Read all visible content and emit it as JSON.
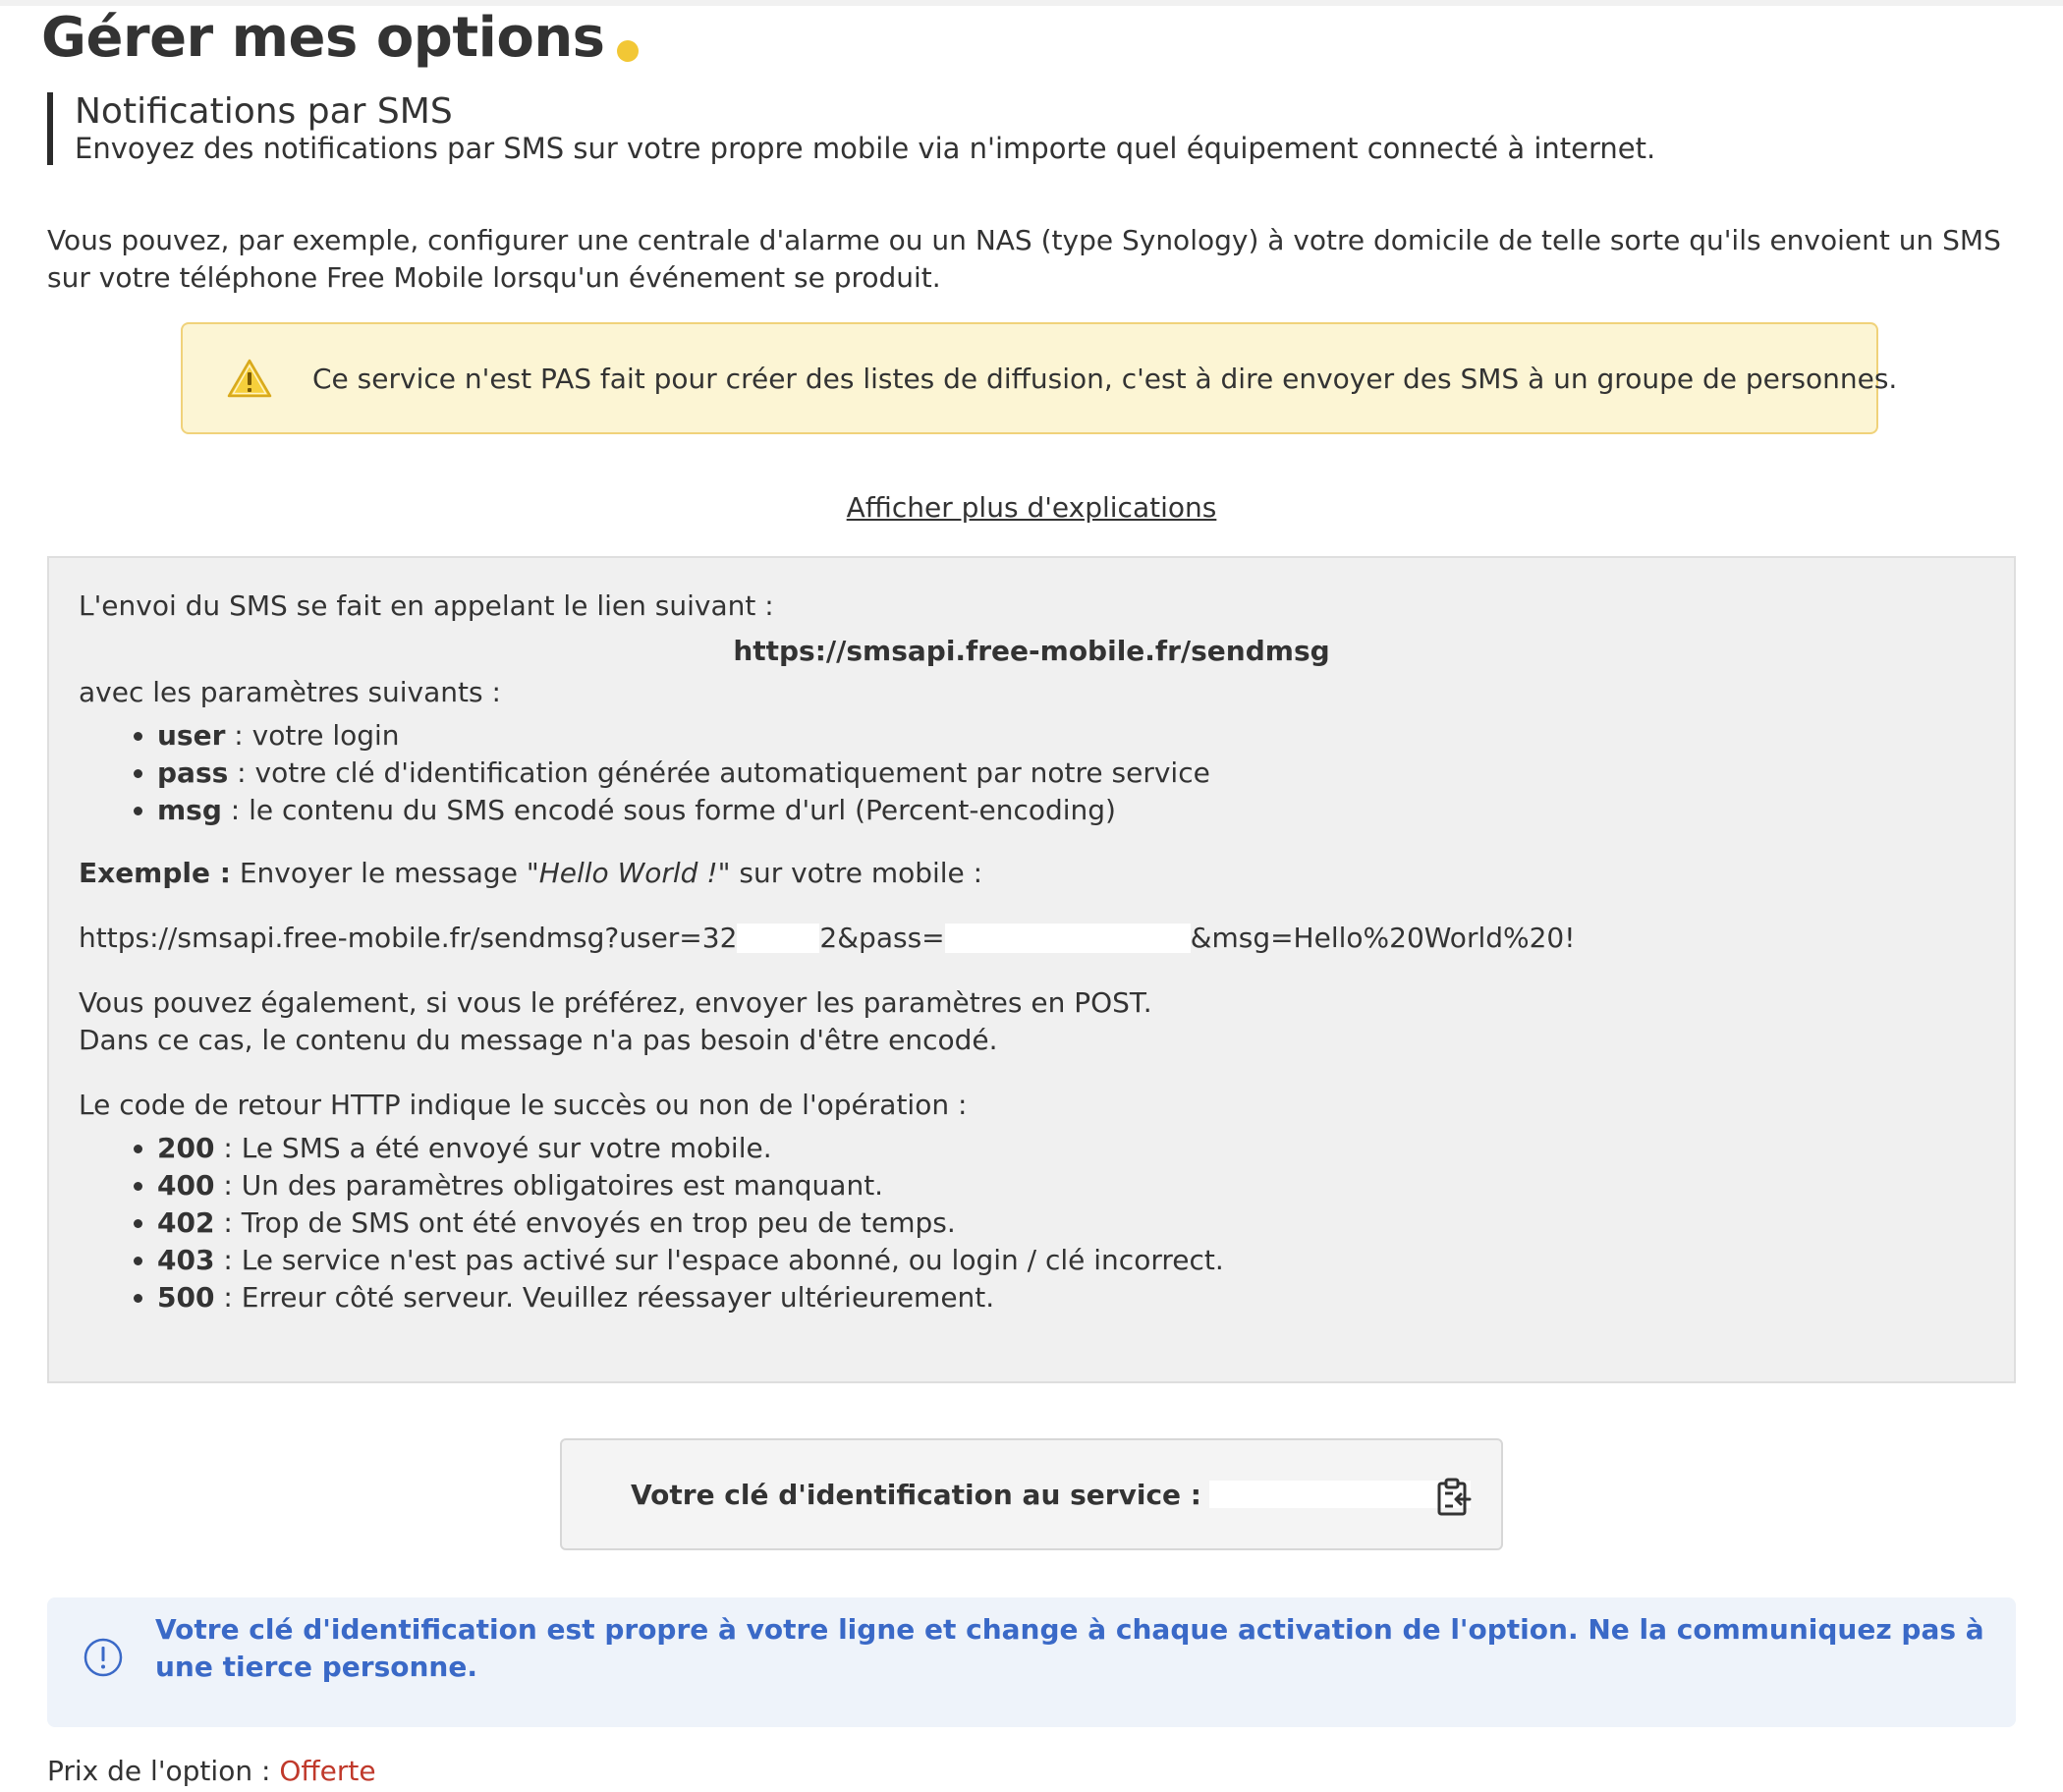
{
  "page": {
    "title": "Gérer mes options"
  },
  "section": {
    "title": "Notifications par SMS",
    "subtitle": "Envoyez des notifications par SMS sur votre propre mobile via n'importe quel équipement connecté à internet."
  },
  "intro": "Vous pouvez, par exemple, configurer une centrale d'alarme ou un NAS (type Synology) à votre domicile de telle sorte qu'ils envoient un SMS sur votre téléphone Free Mobile lorsqu'un événement se produit.",
  "warning": {
    "icon": "warning-triangle-icon",
    "text": "Ce service n'est PAS fait pour créer des listes de diffusion, c'est à dire envoyer des SMS à un groupe de personnes."
  },
  "explain_link": "Afficher plus d'explications",
  "api": {
    "intro": "L'envoi du SMS se fait en appelant le lien suivant :",
    "endpoint": "https://smsapi.free-mobile.fr/sendmsg",
    "params_intro": "avec les paramètres suivants :",
    "params": [
      {
        "name": "user",
        "desc": " : votre login"
      },
      {
        "name": "pass",
        "desc": " : votre clé d'identification générée automatiquement par notre service"
      },
      {
        "name": "msg",
        "desc": " : le contenu du SMS encodé sous forme d'url (Percent-encoding)"
      }
    ],
    "example_label": "Exemple :",
    "example_text1": " Envoyer le message ",
    "example_quote": "\"Hello World !\"",
    "example_text2": " sur votre mobile :",
    "example_url_part1": "https://smsapi.free-mobile.fr/sendmsg?user=32",
    "example_url_part2": "2&pass=",
    "example_url_part3": "&msg=Hello%20World%20!",
    "post_line1": "Vous pouvez également, si vous le préférez, envoyer les paramètres en POST.",
    "post_line2": "Dans ce cas, le contenu du message n'a pas besoin d'être encodé.",
    "codes_intro": "Le code de retour HTTP indique le succès ou non de l'opération :",
    "codes": [
      {
        "code": "200",
        "desc": " : Le SMS a été envoyé sur votre mobile."
      },
      {
        "code": "400",
        "desc": " : Un des paramètres obligatoires est manquant."
      },
      {
        "code": "402",
        "desc": " : Trop de SMS ont été envoyés en trop peu de temps."
      },
      {
        "code": "403",
        "desc": " : Le service n'est pas activé sur l'espace abonné, ou login / clé incorrect."
      },
      {
        "code": "500",
        "desc": " : Erreur côté serveur. Veuillez réessayer ultérieurement."
      }
    ]
  },
  "key_box": {
    "label": "Votre clé d'identification au service :",
    "copy_icon": "clipboard-copy-icon"
  },
  "info": {
    "icon": "info-circle-icon",
    "text": "Votre clé d'identification est propre à votre ligne et change à chaque activation de l'option. Ne la communiquez pas à une tierce personne."
  },
  "price": {
    "label": "Prix de l'option : ",
    "value": "Offerte"
  },
  "colors": {
    "accent_dot": "#f2c735",
    "warning_bg": "#fcf5d4",
    "warning_border": "#f0d27a",
    "info_text": "#3a69c7",
    "price_value": "#c0392b"
  }
}
